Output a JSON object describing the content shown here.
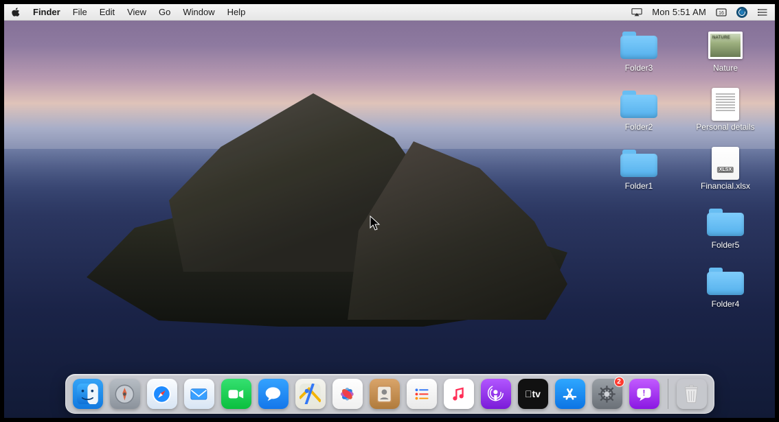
{
  "menubar": {
    "app_name": "Finder",
    "items": [
      "File",
      "Edit",
      "View",
      "Go",
      "Window",
      "Help"
    ],
    "clock": "Mon 5:51 AM"
  },
  "desktop": {
    "column1": [
      {
        "label": "Folder3",
        "kind": "folder"
      },
      {
        "label": "Folder2",
        "kind": "folder"
      },
      {
        "label": "Folder1",
        "kind": "folder"
      }
    ],
    "column2": [
      {
        "label": "Nature",
        "kind": "image"
      },
      {
        "label": "Personal details",
        "kind": "textdoc"
      },
      {
        "label": "Financial.xlsx",
        "kind": "xlsx"
      },
      {
        "label": "Folder5",
        "kind": "folder"
      },
      {
        "label": "Folder4",
        "kind": "folder"
      }
    ],
    "xlsx_badge": "XLSX"
  },
  "dock": {
    "apps": [
      {
        "id": "finder",
        "name": "Finder"
      },
      {
        "id": "launchpad",
        "name": "Launchpad"
      },
      {
        "id": "safari",
        "name": "Safari"
      },
      {
        "id": "mail",
        "name": "Mail"
      },
      {
        "id": "facetime",
        "name": "FaceTime"
      },
      {
        "id": "messages",
        "name": "Messages"
      },
      {
        "id": "maps",
        "name": "Maps"
      },
      {
        "id": "photos",
        "name": "Photos"
      },
      {
        "id": "contacts",
        "name": "Contacts"
      },
      {
        "id": "reminders",
        "name": "Reminders"
      },
      {
        "id": "music",
        "name": "Music"
      },
      {
        "id": "podcasts",
        "name": "Podcasts"
      },
      {
        "id": "tv",
        "name": "TV"
      },
      {
        "id": "appstore",
        "name": "App Store"
      },
      {
        "id": "settings",
        "name": "System Preferences",
        "badge": "2"
      },
      {
        "id": "feedback",
        "name": "Feedback"
      }
    ],
    "trash": "Trash"
  },
  "colors": {
    "folder": "#67bdf2",
    "dock_bg": "rgba(230,230,232,.85)"
  }
}
